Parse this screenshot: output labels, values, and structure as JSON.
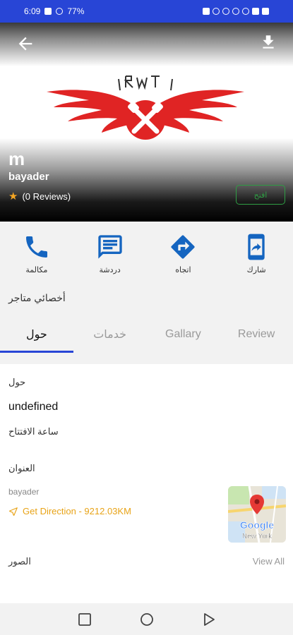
{
  "status_bar": {
    "time": "6:09",
    "battery": "77%"
  },
  "store": {
    "initial": "m",
    "name": "bayader",
    "reviews": "(0 Reviews)",
    "open_status": "افتح",
    "category": "أخصائي متاجر"
  },
  "actions": [
    {
      "label": "مكالمة",
      "icon": "phone-icon"
    },
    {
      "label": "دردشة",
      "icon": "chat-icon"
    },
    {
      "label": "اتجاه",
      "icon": "direction-icon"
    },
    {
      "label": "شارك",
      "icon": "share-icon"
    }
  ],
  "tabs": [
    {
      "label": "حول",
      "active": true
    },
    {
      "label": "خدمات",
      "active": false
    },
    {
      "label": "Gallary",
      "active": false
    },
    {
      "label": "Review",
      "active": false
    }
  ],
  "about": {
    "title": "حول",
    "value": "undefined",
    "opening_hours_title": "ساعة الافتتاح",
    "address_title": "العنوان",
    "address_value": "bayader",
    "direction_label": "Get Direction - 9212.03KM",
    "photos_title": "الصور",
    "view_all": "View All"
  },
  "map": {
    "brand": "Google",
    "city": "New York"
  },
  "colors": {
    "accent": "#2845d6",
    "icon": "#1565c0",
    "open": "#2f9e44",
    "direction": "#e8a317",
    "logo": "#e02424"
  }
}
